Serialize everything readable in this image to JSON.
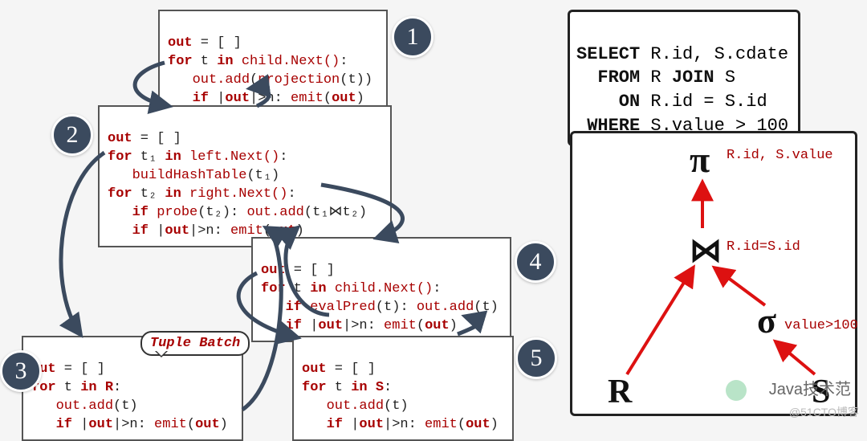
{
  "badges": {
    "b1": "1",
    "b2": "2",
    "b3": "3",
    "b4": "4",
    "b5": "5"
  },
  "box1": {
    "l1a": "out",
    "l1b": " = [ ]",
    "l2a": "for",
    "l2b": " t ",
    "l2c": "in",
    "l2d": " ",
    "l2e": "child.Next()",
    "l2f": ":",
    "l3a": "   ",
    "l3b": "out.add",
    "l3c": "(",
    "l3d": "projection",
    "l3e": "(t))",
    "l4a": "   ",
    "l4b": "if",
    "l4c": " |",
    "l4d": "out",
    "l4e": "|>n: ",
    "l4f": "emit",
    "l4g": "(",
    "l4h": "out",
    "l4i": ")"
  },
  "box2": {
    "l1a": "out",
    "l1b": " = [ ]",
    "l2a": "for",
    "l2b": " t₁ ",
    "l2c": "in",
    "l2d": " ",
    "l2e": "left.Next()",
    "l2f": ":",
    "l3a": "   ",
    "l3b": "buildHashTable",
    "l3c": "(t₁)",
    "l4a": "for",
    "l4b": " t₂ ",
    "l4c": "in",
    "l4d": " ",
    "l4e": "right.Next()",
    "l4f": ":",
    "l5a": "   ",
    "l5b": "if",
    "l5c": " ",
    "l5d": "probe",
    "l5e": "(t₂): ",
    "l5f": "out.add",
    "l5g": "(t₁⋈t₂)",
    "l6a": "   ",
    "l6b": "if",
    "l6c": " |",
    "l6d": "out",
    "l6e": "|>n: ",
    "l6f": "emit",
    "l6g": "(",
    "l6h": "out",
    "l6i": ")"
  },
  "box3": {
    "l1a": "out",
    "l1b": " = [ ]",
    "l2a": "for",
    "l2b": " t ",
    "l2c": "in",
    "l2d": " ",
    "l2e": "R",
    "l2f": ":",
    "l3a": "   ",
    "l3b": "out.add",
    "l3c": "(t)",
    "l4a": "   ",
    "l4b": "if",
    "l4c": " |",
    "l4d": "out",
    "l4e": "|>n: ",
    "l4f": "emit",
    "l4g": "(",
    "l4h": "out",
    "l4i": ")"
  },
  "box4": {
    "l1a": "out",
    "l1b": " = [ ]",
    "l2a": "for",
    "l2b": " t ",
    "l2c": "in",
    "l2d": " ",
    "l2e": "child.Next()",
    "l2f": ":",
    "l3a": "   ",
    "l3b": "if",
    "l3c": " ",
    "l3d": "evalPred",
    "l3e": "(t): ",
    "l3f": "out.add",
    "l3g": "(t)",
    "l4a": "   ",
    "l4b": "if",
    "l4c": " |",
    "l4d": "out",
    "l4e": "|>n: ",
    "l4f": "emit",
    "l4g": "(",
    "l4h": "out",
    "l4i": ")"
  },
  "box5": {
    "l1a": "out",
    "l1b": " = [ ]",
    "l2a": "for",
    "l2b": " t ",
    "l2c": "in",
    "l2d": " ",
    "l2e": "S",
    "l2f": ":",
    "l3a": "   ",
    "l3b": "out.add",
    "l3c": "(t)",
    "l4a": "   ",
    "l4b": "if",
    "l4c": " |",
    "l4d": "out",
    "l4e": "|>n: ",
    "l4f": "emit",
    "l4g": "(",
    "l4h": "out",
    "l4i": ")"
  },
  "sql": {
    "l1a": "SELECT",
    "l1b": " R.id, S.cdate",
    "l2a": "  FROM",
    "l2b": " R ",
    "l2c": "JOIN",
    "l2d": " S",
    "l3a": "    ON",
    "l3b": " R.id = S.id",
    "l4a": " WHERE",
    "l4b": " S.value > 100"
  },
  "tree": {
    "pi": "π",
    "piLabel": "R.id, S.value",
    "join": "⋈",
    "joinLabel": "R.id=S.id",
    "sigma": "σ",
    "sigmaLabel": "value>100",
    "R": "R",
    "S": "S"
  },
  "bubble": "Tuple Batch",
  "watermark1": "Java技术范",
  "watermark2": "@51CTO博客"
}
